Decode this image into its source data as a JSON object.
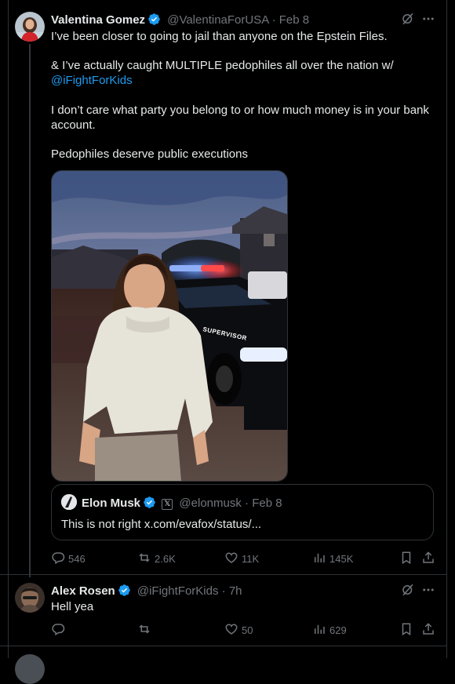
{
  "tweet": {
    "author_name": "Valentina Gomez",
    "author_handle": "@ValentinaForUSA",
    "dot": "·",
    "time": "Feb 8",
    "p1": "I’ve been closer to going to jail than anyone on the Epstein Files.",
    "p2_prefix": "& I’ve actually caught MULTIPLE pedophiles all over the nation w/",
    "p2_link": "@iFightForKids",
    "p3": "I don’t care what party you belong to or how much money is in your bank account.",
    "p4": "Pedophiles deserve public executions",
    "photo_text": "SUPERVISOR",
    "quote": {
      "author_name": "Elon Musk",
      "x_badge": "𝕏",
      "author_handle": "@elonmusk",
      "dot": "·",
      "time": "Feb 8",
      "text": "This is not right x.com/evafox/status/..."
    },
    "actions": {
      "replies": "546",
      "reposts": "2.6K",
      "likes": "11K",
      "views": "145K"
    }
  },
  "reply": {
    "author_name": "Alex Rosen",
    "author_handle": "@iFightForKids",
    "dot": "·",
    "time": "7h",
    "text": "Hell yea",
    "actions": {
      "likes": "50",
      "views": "629"
    }
  },
  "colors": {
    "background": "#000000",
    "text": "#e7e9ea",
    "muted": "#71767b",
    "link": "#1d9bf0",
    "verified": "#1d9bf0",
    "border": "#2f3336"
  },
  "icons": [
    "verified-badge-icon",
    "grok-icon",
    "more-icon",
    "reply-icon",
    "repost-icon",
    "like-icon",
    "views-icon",
    "bookmark-icon",
    "share-icon"
  ]
}
